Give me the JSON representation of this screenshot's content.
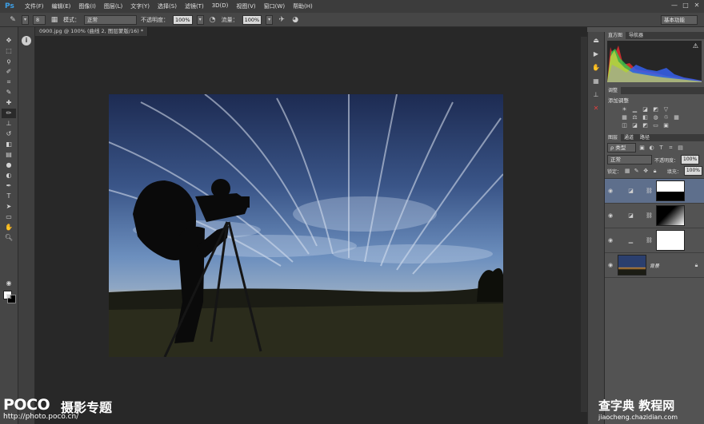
{
  "app": {
    "logo_text": "Ps"
  },
  "menu": [
    "文件(F)",
    "编辑(E)",
    "图像(I)",
    "图层(L)",
    "文字(Y)",
    "选择(S)",
    "滤镜(T)",
    "3D(D)",
    "视图(V)",
    "窗口(W)",
    "帮助(H)"
  ],
  "window_buttons": [
    "—",
    "□",
    "✕"
  ],
  "options_bar": {
    "brush_size": "8",
    "mode_label": "模式：",
    "mode_value": "正常",
    "opacity_label": "不透明度：",
    "opacity_value": "100%",
    "flow_label": "流量：",
    "flow_value": "100%",
    "workspace_value": "基本功能"
  },
  "document_tab": "0900.jpg @ 100% (曲线 2, 图层蒙版/16) *",
  "panels": {
    "histogram_tabs": [
      "直方图",
      "导航器"
    ],
    "histogram_warning": "⚠",
    "adjustments_tab": "调整",
    "adjustments_subtitle": "添加调整",
    "layers_tabs": [
      "图层",
      "通道",
      "路径"
    ],
    "filter_kind": "ρ 类型",
    "blend_mode": "正常",
    "opacity_label": "不透明度：",
    "opacity_value": "100%",
    "lock_label": "锁定：",
    "fill_label": "填充：",
    "fill_value": "100%",
    "layers": [
      {
        "type": "curves",
        "selected": true,
        "mask": "top-white"
      },
      {
        "type": "curves",
        "selected": false,
        "mask": "gradient"
      },
      {
        "type": "levels",
        "selected": false,
        "mask": "white"
      },
      {
        "type": "image",
        "selected": false,
        "name": "背景",
        "locked": true
      }
    ]
  },
  "watermarks": {
    "poco": "POCO",
    "poco_sub": "摄影专题",
    "poco_url": "http://photo.poco.cn/",
    "czd": "查字典 教程网",
    "czd_url": "jiaocheng.chazidian.com"
  }
}
